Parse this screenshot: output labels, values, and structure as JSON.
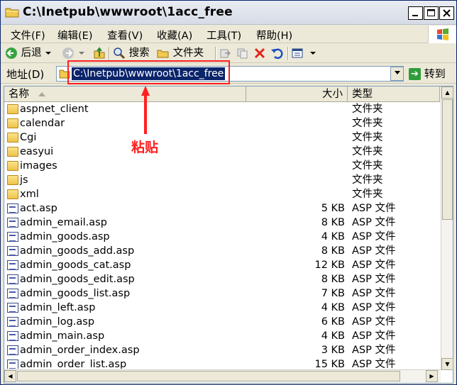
{
  "window": {
    "title": "C:\\Inetpub\\wwwroot\\1acc_free"
  },
  "menu": [
    {
      "label": "文件(F)"
    },
    {
      "label": "编辑(E)"
    },
    {
      "label": "查看(V)"
    },
    {
      "label": "收藏(A)"
    },
    {
      "label": "工具(T)"
    },
    {
      "label": "帮助(H)"
    }
  ],
  "toolbar": {
    "back_label": "后退",
    "search_label": "搜索",
    "folders_label": "文件夹"
  },
  "address": {
    "label": "地址(D)",
    "value": "C:\\Inetpub\\wwwroot\\1acc_free",
    "go_label": "转到"
  },
  "annotation": {
    "text": "粘贴",
    "color": "#ff2020"
  },
  "columns": {
    "name": "名称",
    "size": "大小",
    "type": "类型"
  },
  "files": [
    {
      "name": "aspnet_client",
      "size": "",
      "type": "文件夹",
      "kind": "folder"
    },
    {
      "name": "calendar",
      "size": "",
      "type": "文件夹",
      "kind": "folder"
    },
    {
      "name": "Cgi",
      "size": "",
      "type": "文件夹",
      "kind": "folder"
    },
    {
      "name": "easyui",
      "size": "",
      "type": "文件夹",
      "kind": "folder"
    },
    {
      "name": "images",
      "size": "",
      "type": "文件夹",
      "kind": "folder"
    },
    {
      "name": "js",
      "size": "",
      "type": "文件夹",
      "kind": "folder"
    },
    {
      "name": "xml",
      "size": "",
      "type": "文件夹",
      "kind": "folder"
    },
    {
      "name": "act.asp",
      "size": "5 KB",
      "type": "ASP 文件",
      "kind": "file"
    },
    {
      "name": "admin_email.asp",
      "size": "8 KB",
      "type": "ASP 文件",
      "kind": "file"
    },
    {
      "name": "admin_goods.asp",
      "size": "4 KB",
      "type": "ASP 文件",
      "kind": "file"
    },
    {
      "name": "admin_goods_add.asp",
      "size": "8 KB",
      "type": "ASP 文件",
      "kind": "file"
    },
    {
      "name": "admin_goods_cat.asp",
      "size": "12 KB",
      "type": "ASP 文件",
      "kind": "file"
    },
    {
      "name": "admin_goods_edit.asp",
      "size": "8 KB",
      "type": "ASP 文件",
      "kind": "file"
    },
    {
      "name": "admin_goods_list.asp",
      "size": "7 KB",
      "type": "ASP 文件",
      "kind": "file"
    },
    {
      "name": "admin_left.asp",
      "size": "4 KB",
      "type": "ASP 文件",
      "kind": "file"
    },
    {
      "name": "admin_log.asp",
      "size": "6 KB",
      "type": "ASP 文件",
      "kind": "file"
    },
    {
      "name": "admin_main.asp",
      "size": "4 KB",
      "type": "ASP 文件",
      "kind": "file"
    },
    {
      "name": "admin_order_index.asp",
      "size": "3 KB",
      "type": "ASP 文件",
      "kind": "file"
    },
    {
      "name": "admin_order_list.asp",
      "size": "15 KB",
      "type": "ASP 文件",
      "kind": "file"
    }
  ]
}
